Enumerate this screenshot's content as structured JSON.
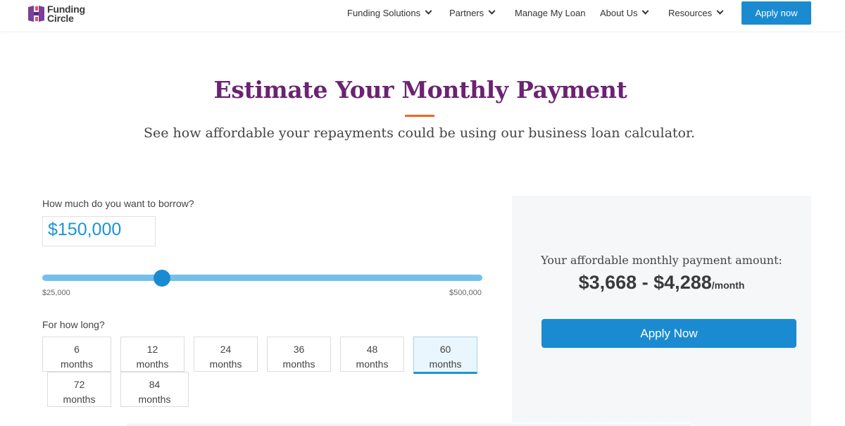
{
  "header": {
    "logo": {
      "line1": "Funding",
      "line2": "Circle"
    },
    "nav": [
      {
        "label": "Funding Solutions",
        "has_dropdown": true
      },
      {
        "label": "Partners",
        "has_dropdown": true
      },
      {
        "label": "Manage My Loan",
        "has_dropdown": false
      },
      {
        "label": "About Us",
        "has_dropdown": true
      },
      {
        "label": "Resources",
        "has_dropdown": true
      }
    ],
    "apply_label": "Apply now"
  },
  "hero": {
    "title": "Estimate Your Monthly Payment",
    "subtitle": "See how affordable your repayments could be using our business loan calculator."
  },
  "calculator": {
    "borrow_question": "How much do you want to borrow?",
    "amount": "$150,000",
    "slider": {
      "min_label": "$25,000",
      "max_label": "$500,000",
      "value": 150000,
      "min": 25000,
      "max": 500000
    },
    "term_question": "For how long?",
    "terms": [
      {
        "value": "6",
        "unit": "months",
        "selected": false
      },
      {
        "value": "12",
        "unit": "months",
        "selected": false
      },
      {
        "value": "24",
        "unit": "months",
        "selected": false
      },
      {
        "value": "36",
        "unit": "months",
        "selected": false
      },
      {
        "value": "48",
        "unit": "months",
        "selected": false
      },
      {
        "value": "60",
        "unit": "months",
        "selected": true
      },
      {
        "value": "72",
        "unit": "months",
        "selected": false
      },
      {
        "value": "84",
        "unit": "months",
        "selected": false
      }
    ]
  },
  "result": {
    "label": "Your affordable monthly payment amount:",
    "range": "$3,668 - $4,288",
    "per": "/month",
    "apply_label": "Apply Now"
  },
  "colors": {
    "title_purple": "#6b2372",
    "accent_orange": "#f26722",
    "brand_blue": "#1a8bd1",
    "amount_blue": "#1a95d6"
  }
}
